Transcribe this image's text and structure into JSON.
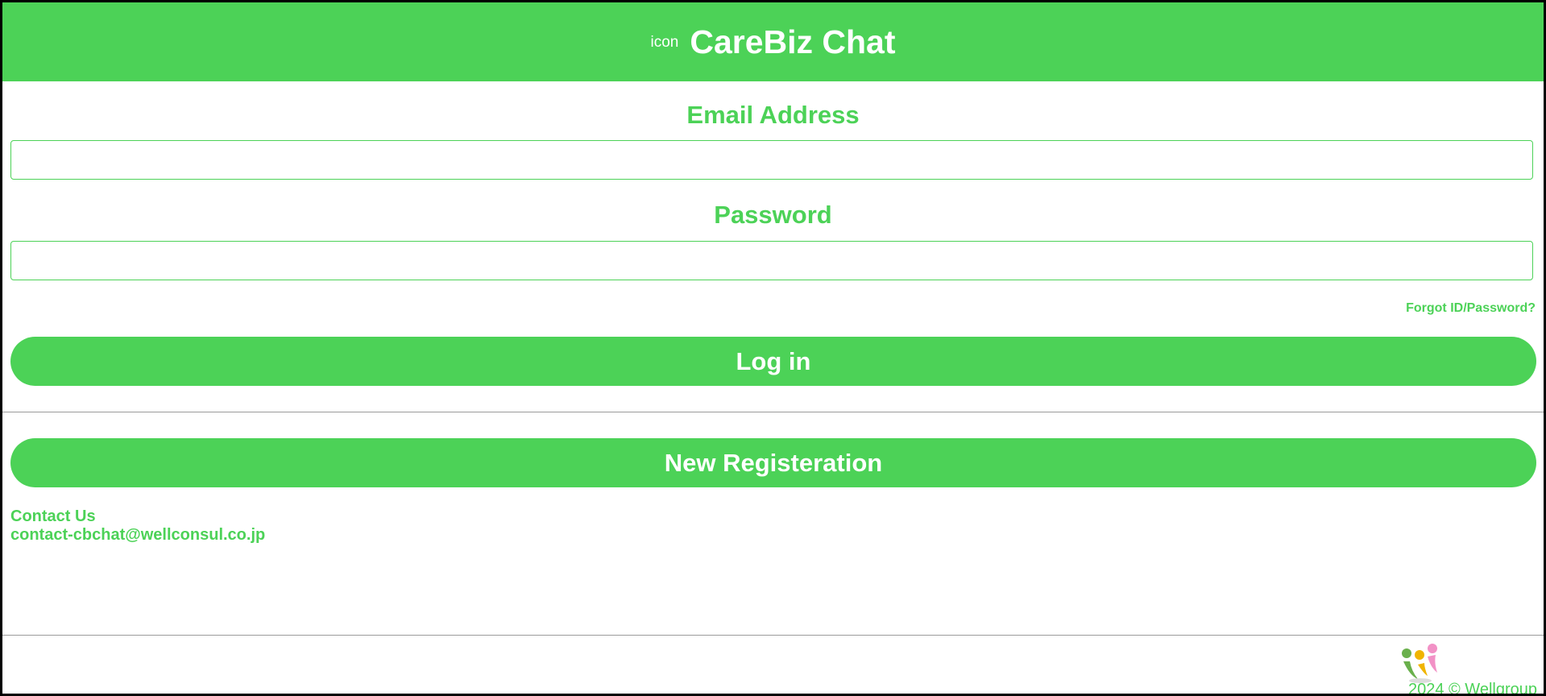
{
  "header": {
    "icon_alt": "icon",
    "title": "CareBiz Chat"
  },
  "form": {
    "email_label": "Email Address",
    "email_value": "",
    "password_label": "Password",
    "password_value": "",
    "forgot_link": "Forgot ID/Password?",
    "login_button": "Log in",
    "register_button": "New Registeration"
  },
  "contact": {
    "title": "Contact Us",
    "email": "contact-cbchat@wellconsul.co.jp"
  },
  "footer": {
    "logo_icon": "wellgroup-logo-icon",
    "copyright": "2024 © Wellgroup"
  },
  "colors": {
    "brand": "#4cd257",
    "divider": "#9a9a9a"
  }
}
